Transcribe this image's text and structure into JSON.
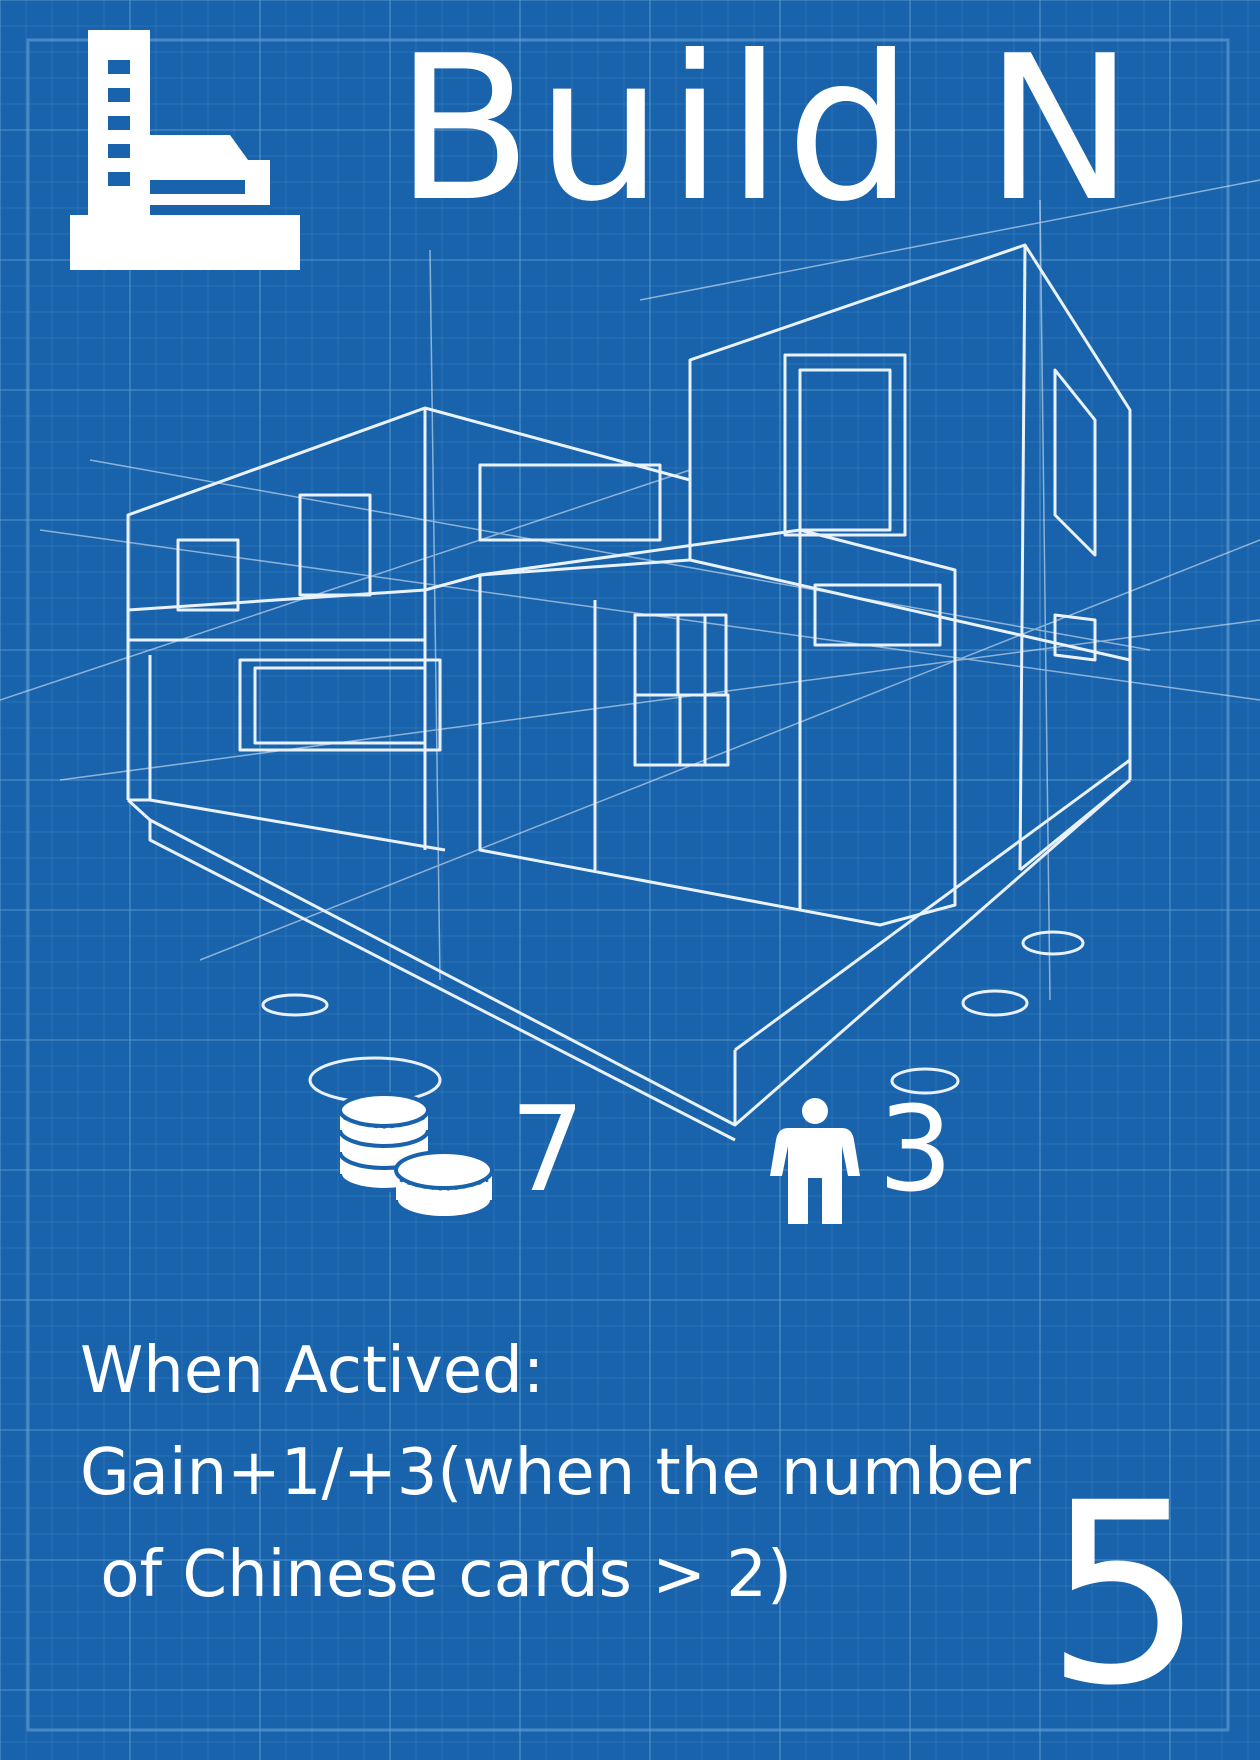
{
  "card": {
    "title": "Build N",
    "cost": {
      "icon": "coins-icon",
      "value": "7"
    },
    "workers": {
      "icon": "person-icon",
      "value": "3"
    },
    "effect": {
      "line1": "When Actived:",
      "line2": "Gain+1/+3(when the number",
      "line3": " of Chinese cards > 2)"
    },
    "points": "5",
    "type_icon": "building-icon"
  },
  "colors": {
    "background": "#1863ab",
    "text": "#ffffff",
    "grid": "#5d9ad0"
  }
}
